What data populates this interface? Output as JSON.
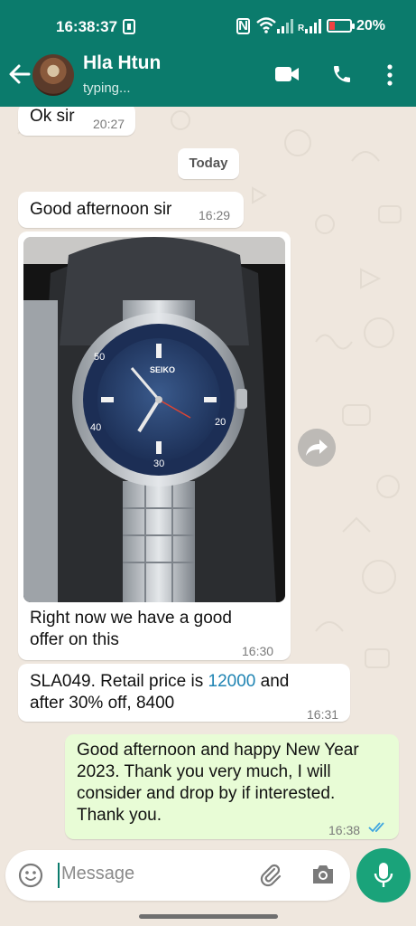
{
  "status_bar": {
    "time": "16:38:37",
    "nfc": "N",
    "battery_pct": "20%"
  },
  "header": {
    "contact_name": "Hla Htun",
    "status": "typing..."
  },
  "colors": {
    "header": "#0b7b6c",
    "outgoing": "#e8fcd6",
    "incoming": "#ffffff",
    "link": "#1f84b3",
    "mic": "#1aa37a"
  },
  "messages": [
    {
      "text": "Ok sir",
      "time": "20:27"
    },
    {
      "date": "Today"
    },
    {
      "text": "Good afternoon sir",
      "time": "16:29"
    },
    {
      "caption_line1": "Right now we have a good",
      "caption_line2": "offer on this",
      "time": "16:30"
    },
    {
      "text_pre": "SLA049. Retail price is ",
      "price": "12000",
      "text_post": " and",
      "line2": "after 30% off, 8400",
      "time": "16:31"
    },
    {
      "line1": "Good afternoon and happy New Year",
      "line2": "2023. Thank you very much, I will",
      "line3": "consider and drop by if interested.",
      "line4": "Thank you.",
      "time": "16:38"
    }
  ],
  "watch": {
    "brand": "SEIKO",
    "bezel_markers": [
      "50",
      "40",
      "30",
      "20"
    ]
  },
  "input": {
    "placeholder": "Message"
  }
}
